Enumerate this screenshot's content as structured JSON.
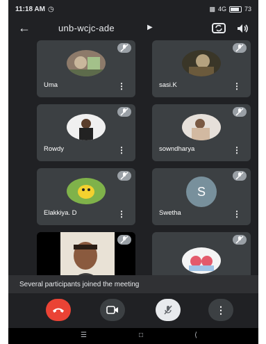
{
  "status_bar": {
    "time": "11:18 AM",
    "network_text": "4G",
    "battery_text": "73"
  },
  "header": {
    "meeting_code": "unb-wcjc-ade",
    "icons": [
      "back-arrow-icon",
      "switch-camera-icon",
      "speaker-icon"
    ]
  },
  "participants": [
    {
      "name": "Uma",
      "muted": true,
      "avatar": "photo"
    },
    {
      "name": "sasi.K",
      "muted": true,
      "avatar": "photo"
    },
    {
      "name": "Rowdy",
      "muted": true,
      "avatar": "photo"
    },
    {
      "name": "sowndharya",
      "muted": true,
      "avatar": "photo"
    },
    {
      "name": "Elakkiya. D",
      "muted": true,
      "avatar": "photo"
    },
    {
      "name": "Swetha",
      "muted": true,
      "avatar": "letter",
      "initial": "S"
    },
    {
      "name": "",
      "muted": true,
      "avatar": "video"
    },
    {
      "name": "",
      "muted": true,
      "avatar": "photo"
    }
  ],
  "toast": {
    "message": "Several participants joined the meeting"
  },
  "controls": {
    "end_call_color": "#ea4335",
    "buttons": [
      "end-call-icon",
      "camera-icon",
      "mic-off-icon",
      "more-options-icon"
    ]
  },
  "colors": {
    "background": "#202124",
    "tile": "#3c4043",
    "text": "#e8eaed"
  }
}
